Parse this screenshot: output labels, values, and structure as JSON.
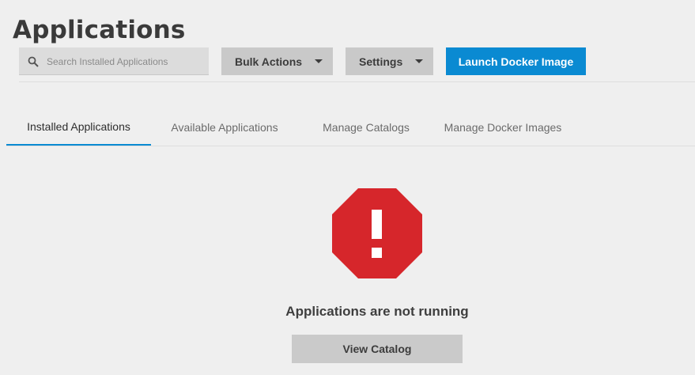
{
  "page": {
    "title": "Applications"
  },
  "toolbar": {
    "search_placeholder": "Search Installed Applications",
    "bulk_actions_label": "Bulk Actions",
    "settings_label": "Settings",
    "launch_docker_label": "Launch Docker Image"
  },
  "tabs": [
    {
      "label": "Installed Applications",
      "active": true
    },
    {
      "label": "Available Applications",
      "active": false
    },
    {
      "label": "Manage Catalogs",
      "active": false
    },
    {
      "label": "Manage Docker Images",
      "active": false
    }
  ],
  "empty_state": {
    "icon": "error-octagon-icon",
    "message": "Applications are not running",
    "button_label": "View Catalog"
  },
  "colors": {
    "accent": "#0a8ad2",
    "error": "#d6262b",
    "background": "#efefef"
  }
}
